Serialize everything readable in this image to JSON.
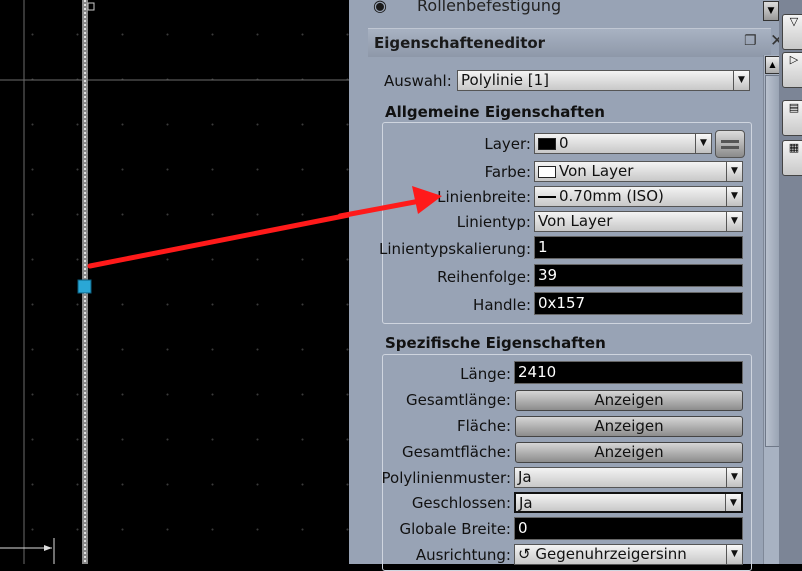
{
  "top_item": {
    "label": "Rollenbefestigung",
    "icon": "eye-icon"
  },
  "panel": {
    "title": "Eigenschafteneditor",
    "restore_icon": "restore-window-icon",
    "close_icon": "close-icon"
  },
  "selection": {
    "label": "Auswahl:",
    "value": "Polylinie [1]"
  },
  "general": {
    "title": "Allgemeine Eigenschaften",
    "layer": {
      "label": "Layer:",
      "value": "0"
    },
    "color": {
      "label": "Farbe:",
      "value": "Von Layer"
    },
    "lineweight": {
      "label": "Linienbreite:",
      "value": "0.70mm (ISO)"
    },
    "linetype": {
      "label": "Linientyp:",
      "value": "Von Layer"
    },
    "linetype_scale": {
      "label": "Linientypskalierung:",
      "value": "1"
    },
    "order": {
      "label": "Reihenfolge:",
      "value": "39"
    },
    "handle": {
      "label": "Handle:",
      "value": "0x157"
    }
  },
  "specific": {
    "title": "Spezifische Eigenschaften",
    "length": {
      "label": "Länge:",
      "value": "2410"
    },
    "total_length": {
      "label": "Gesamtlänge:",
      "button": "Anzeigen"
    },
    "area": {
      "label": "Fläche:",
      "button": "Anzeigen"
    },
    "total_area": {
      "label": "Gesamtfläche:",
      "button": "Anzeigen"
    },
    "pattern": {
      "label": "Polylinienmuster:",
      "value": "Ja"
    },
    "closed": {
      "label": "Geschlossen:",
      "value": "Ja"
    },
    "global_width": {
      "label": "Globale Breite:",
      "value": "0"
    },
    "orientation": {
      "label": "Ausrichtung:",
      "value": "Gegenuhrzeigersinn"
    }
  },
  "colors": {
    "arrow": "#ff1a1a",
    "grip": "#2aa7d6",
    "panel_bg": "#98a3b5"
  }
}
